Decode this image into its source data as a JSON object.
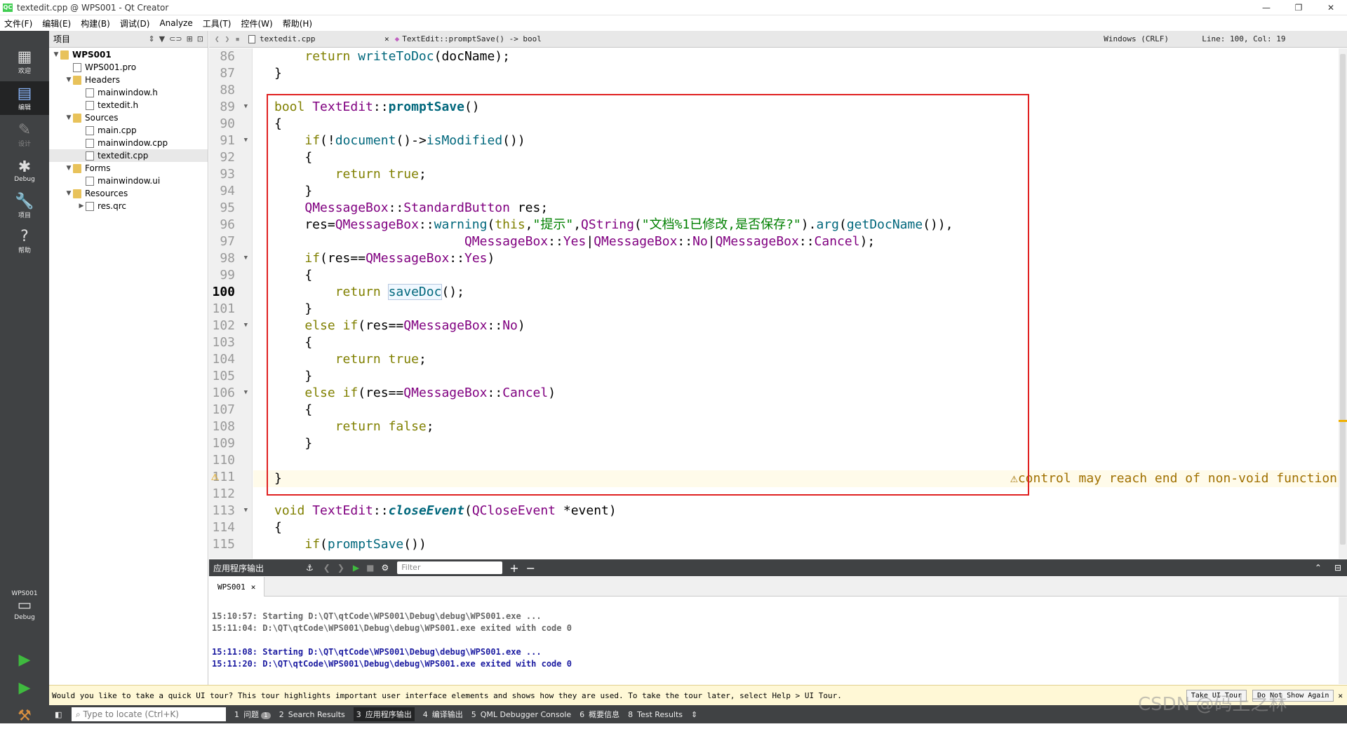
{
  "window": {
    "title": "textedit.cpp @ WPS001 - Qt Creator",
    "app_icon": "QC"
  },
  "menu": [
    "文件(F)",
    "编辑(E)",
    "构建(B)",
    "调试(D)",
    "Analyze",
    "工具(T)",
    "控件(W)",
    "帮助(H)"
  ],
  "modes": [
    {
      "label": "欢迎",
      "icon": "grid-icon"
    },
    {
      "label": "编辑",
      "icon": "document-icon"
    },
    {
      "label": "设计",
      "icon": "pencil-icon"
    },
    {
      "label": "Debug",
      "icon": "bug-icon"
    },
    {
      "label": "项目",
      "icon": "wrench-icon"
    },
    {
      "label": "帮助",
      "icon": "help-icon"
    }
  ],
  "kit": {
    "project": "WPS001",
    "config": "Debug"
  },
  "project_panel": {
    "title": "项目",
    "tree": [
      {
        "label": "WPS001",
        "level": 0,
        "type": "project"
      },
      {
        "label": "WPS001.pro",
        "level": 1,
        "type": "file"
      },
      {
        "label": "Headers",
        "level": 1,
        "type": "folder"
      },
      {
        "label": "mainwindow.h",
        "level": 2,
        "type": "file"
      },
      {
        "label": "textedit.h",
        "level": 2,
        "type": "file"
      },
      {
        "label": "Sources",
        "level": 1,
        "type": "folder"
      },
      {
        "label": "main.cpp",
        "level": 2,
        "type": "file"
      },
      {
        "label": "mainwindow.cpp",
        "level": 2,
        "type": "file"
      },
      {
        "label": "textedit.cpp",
        "level": 2,
        "type": "file"
      },
      {
        "label": "Forms",
        "level": 1,
        "type": "folder"
      },
      {
        "label": "mainwindow.ui",
        "level": 2,
        "type": "file"
      },
      {
        "label": "Resources",
        "level": 1,
        "type": "folder"
      },
      {
        "label": "res.qrc",
        "level": 2,
        "type": "file"
      }
    ]
  },
  "editor": {
    "file_tab": "textedit.cpp",
    "symbol": "TextEdit::promptSave() -> bool",
    "line_ending": "Windows (CRLF)",
    "position": "Line: 100, Col: 19",
    "current_line": "100",
    "warning_line": "111",
    "warning_text": "control may reach end of non-void function",
    "line_numbers": [
      "86",
      "87",
      "88",
      "89",
      "90",
      "91",
      "92",
      "93",
      "94",
      "95",
      "96",
      "97",
      "98",
      "99",
      "100",
      "101",
      "102",
      "103",
      "104",
      "105",
      "106",
      "107",
      "108",
      "109",
      "110",
      "111",
      "112",
      "113",
      "114",
      "115"
    ]
  },
  "output_pane": {
    "title": "应用程序输出",
    "filter_placeholder": "Filter",
    "tab": "WPS001",
    "lines": [
      "15:10:57: Starting D:\\QT\\qtCode\\WPS001\\Debug\\debug\\WPS001.exe ...",
      "15:11:04: D:\\QT\\qtCode\\WPS001\\Debug\\debug\\WPS001.exe exited with code 0",
      "15:11:08: Starting D:\\QT\\qtCode\\WPS001\\Debug\\debug\\WPS001.exe ...",
      "15:11:20: D:\\QT\\qtCode\\WPS001\\Debug\\debug\\WPS001.exe exited with code 0"
    ]
  },
  "infobar": {
    "text": "Would you like to take a quick UI tour? This tour highlights important user interface elements and shows how they are used. To take the tour later, select Help > UI Tour.",
    "take_tour": "Take UI Tour",
    "dont_show": "Do Not Show Again"
  },
  "statusbar": {
    "locator_placeholder": "Type to locate (Ctrl+K)",
    "tabs": [
      {
        "n": "1",
        "label": "问题",
        "badge": "1"
      },
      {
        "n": "2",
        "label": "Search Results"
      },
      {
        "n": "3",
        "label": "应用程序输出"
      },
      {
        "n": "4",
        "label": "编译输出"
      },
      {
        "n": "5",
        "label": "QML Debugger Console"
      },
      {
        "n": "6",
        "label": "概要信息"
      },
      {
        "n": "8",
        "label": "Test Results"
      }
    ]
  },
  "watermark": "CSDN @码上之林",
  "colors": {
    "sidebar": "#404244",
    "highlight_box": "#e02020",
    "keyword": "#808000",
    "type": "#800080",
    "string": "#008000"
  }
}
